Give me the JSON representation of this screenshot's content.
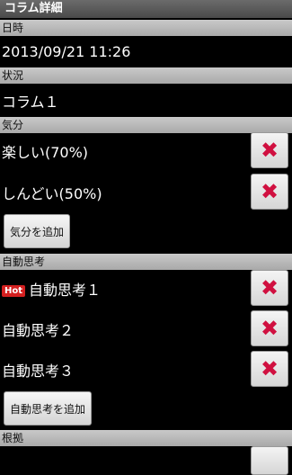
{
  "window": {
    "title": "コラム詳細"
  },
  "datetime": {
    "header": "日時",
    "value": "2013/09/21 11:26"
  },
  "status": {
    "header": "状況",
    "value": "コラム１"
  },
  "mood": {
    "header": "気分",
    "items": [
      {
        "label": "楽しい(70%)"
      },
      {
        "label": "しんどい(50%)"
      }
    ],
    "add_label": "気分を追加"
  },
  "auto_thought": {
    "header": "自動思考",
    "items": [
      {
        "label": "自動思考１",
        "badge": "Hot"
      },
      {
        "label": "自動思考２"
      },
      {
        "label": "自動思考３"
      }
    ],
    "add_label": "自動思考を追加"
  },
  "evidence": {
    "header": "根拠"
  },
  "delete_glyph": "✖",
  "colors": {
    "accent_red": "#d01040",
    "hot_badge": "#d42020"
  }
}
